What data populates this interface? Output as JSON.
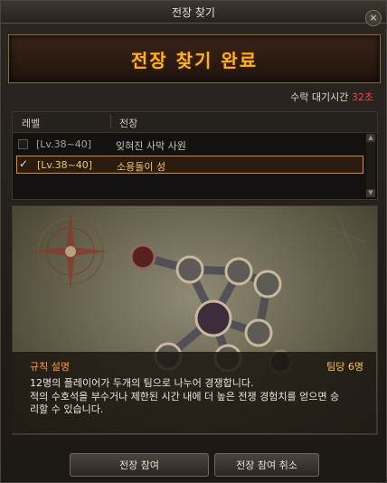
{
  "window": {
    "title": "전장 찾기",
    "close_label": "×"
  },
  "banner": {
    "title": "전장 찾기 완료"
  },
  "wait": {
    "label": "수락 대기시간",
    "value": "32초"
  },
  "table": {
    "headers": {
      "level": "레벨",
      "battlefield": "전장"
    },
    "rows": [
      {
        "level": "[Lv.38~40]",
        "name": "잊혀진 사막 사원",
        "selected": false
      },
      {
        "level": "[Lv.38~40]",
        "name": "소용돌이 성",
        "selected": true
      }
    ]
  },
  "rules": {
    "heading": "규칙 설명",
    "team": "팀당 6명",
    "lines": [
      "12명의 플레이어가 두개의 팀으로 나누어 경쟁합니다.",
      "적의 수호석을 부수거나 제한된 시간 내에 더 높은 전쟁 경험치를 얻으면 승",
      "리할 수 있습니다."
    ]
  },
  "buttons": {
    "join": "전장 참여",
    "cancel": "전장 참여 취소"
  },
  "icons": {
    "close": "close-icon",
    "check": "check-icon",
    "scroll_up": "scroll-up-icon",
    "scroll_down": "scroll-down-icon"
  },
  "colors": {
    "accent_orange": "#ffb21c",
    "timer_red": "#ff4040",
    "selection_border": "#e08a1e"
  }
}
